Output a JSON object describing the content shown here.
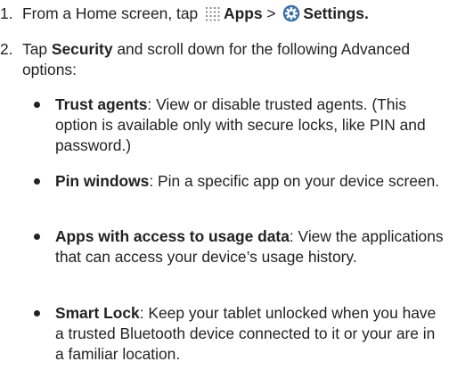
{
  "steps": [
    {
      "number": "1.",
      "text_before": "From a Home screen, tap",
      "apps_icon": "apps-grid-icon",
      "apps_label": "Apps",
      "separator": ">",
      "settings_icon": "settings-gear-icon",
      "settings_label": "Settings",
      "end": "."
    },
    {
      "number": "2.",
      "text_before": "Tap",
      "bold_label": "Security",
      "text_after": "and scroll down for the following Advanced options:"
    }
  ],
  "options": [
    {
      "name": "Trust agents",
      "description": ": View or disable trusted agents. (This option is available only with secure locks, like PIN and password.)"
    },
    {
      "name": "Pin windows",
      "description": ": Pin a specific app on your device screen."
    },
    {
      "name": "Apps with access to usage data",
      "description": ": View the applications that can access your device’s usage history."
    },
    {
      "name": "Smart Lock",
      "description": ": Keep your tablet unlocked when you have a trusted Bluetooth device connected to it or your are in a familiar location."
    }
  ],
  "colors": {
    "text": "#222222",
    "settings_icon_fill": "#3f6fa8",
    "apps_icon_dots": "#8a8a8a"
  }
}
